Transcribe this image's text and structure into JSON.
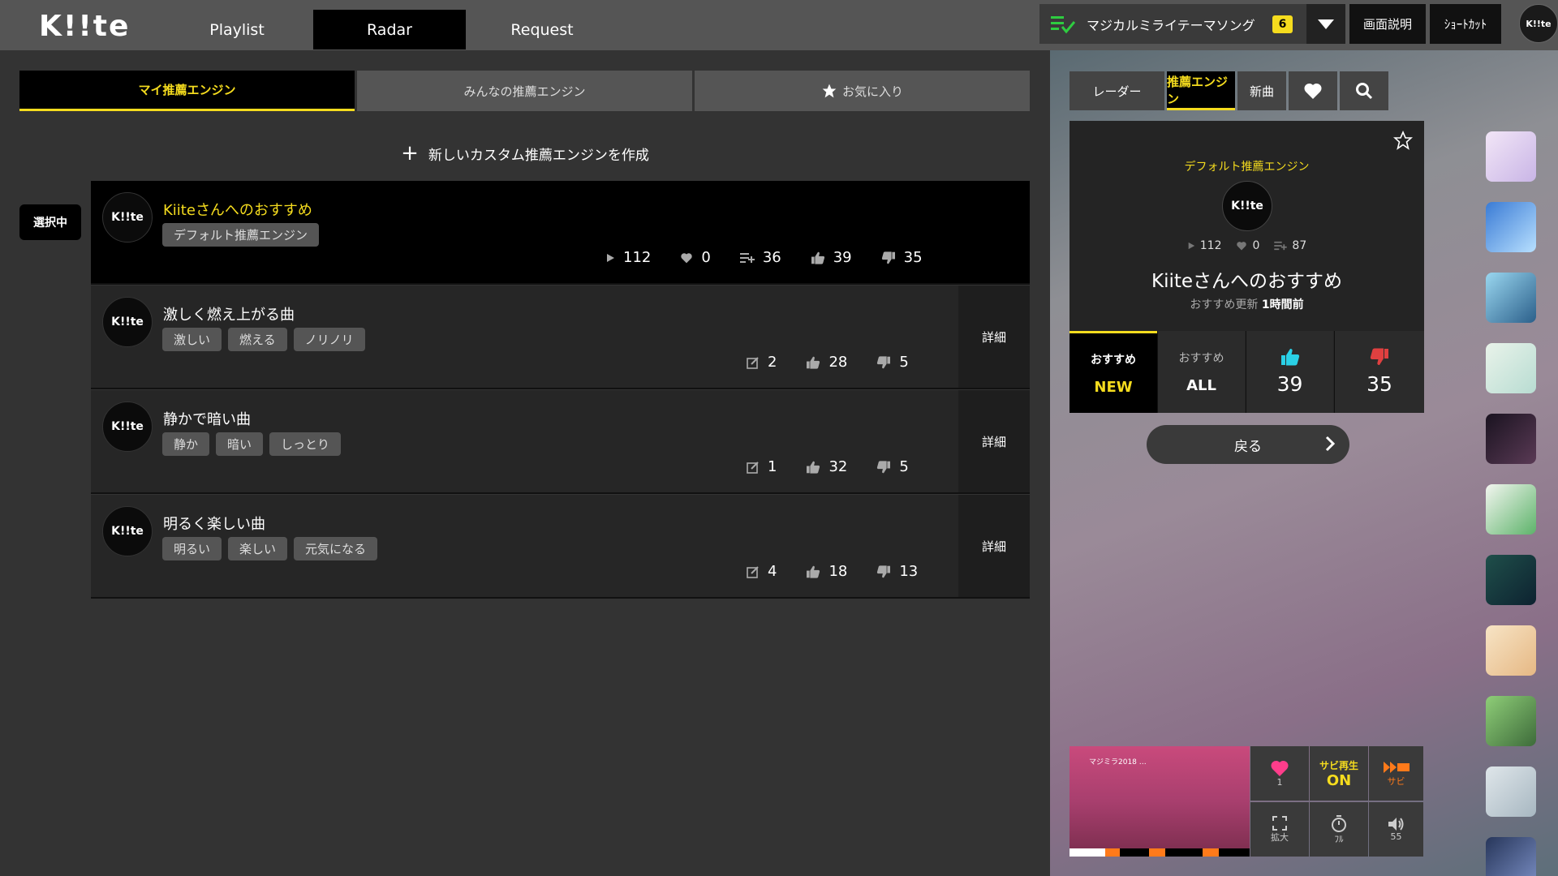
{
  "app": {
    "logo": "K!!te"
  },
  "nav": {
    "tabs": [
      {
        "label": "Playlist"
      },
      {
        "label": "Radar"
      },
      {
        "label": "Request"
      }
    ]
  },
  "header": {
    "queue_title": "マジカルミライテーマソング",
    "queue_count": "6",
    "help_label": "画面説明",
    "shortcut_label": "ｼｮｰﾄｶｯﾄ",
    "avatar_label": "K!!te"
  },
  "engine_tabs": [
    {
      "label": "マイ推薦エンジン"
    },
    {
      "label": "みんなの推薦エンジン"
    },
    {
      "label": "お気に入り"
    }
  ],
  "create_label": "新しいカスタム推薦エンジンを作成",
  "selected_label": "選択中",
  "engines": [
    {
      "icon": "K!!te",
      "title": "Kiiteさんへのおすすめ",
      "tags": [
        "デフォルト推薦エンジン"
      ],
      "plays": "112",
      "favs": "0",
      "lists": "36",
      "up": "39",
      "down": "35"
    },
    {
      "icon": "K!!te",
      "title": "激しく燃え上がる曲",
      "tags": [
        "激しい",
        "燃える",
        "ノリノリ"
      ],
      "edits": "2",
      "up": "28",
      "down": "5",
      "detail": "詳細"
    },
    {
      "icon": "K!!te",
      "title": "静かで暗い曲",
      "tags": [
        "静か",
        "暗い",
        "しっとり"
      ],
      "edits": "1",
      "up": "32",
      "down": "5",
      "detail": "詳細"
    },
    {
      "icon": "K!!te",
      "title": "明るく楽しい曲",
      "tags": [
        "明るい",
        "楽しい",
        "元気になる"
      ],
      "edits": "4",
      "up": "18",
      "down": "13",
      "detail": "詳細"
    }
  ],
  "right": {
    "tabs": [
      {
        "label": "レーダー"
      },
      {
        "label": "推薦エンジン"
      },
      {
        "label": "新曲"
      }
    ],
    "card": {
      "default_label": "デフォルト推薦エンジン",
      "icon": "K!!te",
      "plays": "112",
      "favs": "0",
      "lists": "87",
      "title": "Kiiteさんへのおすすめ",
      "updated_prefix": "おすすめ更新",
      "updated_value": "1時間前",
      "buttons": [
        {
          "l1": "おすすめ",
          "l2": "NEW"
        },
        {
          "l1": "おすすめ",
          "l2": "ALL"
        },
        {
          "value": "39"
        },
        {
          "value": "35"
        }
      ]
    },
    "back_label": "戻る",
    "player": {
      "video_text": "マジミラ2018 …",
      "fav_count": "1",
      "sabi_label": "サビ再生",
      "sabi_state": "ON",
      "sabi_btn": "サビ",
      "expand": "拡大",
      "full": "ﾌﾙ",
      "volume": "55"
    }
  },
  "colors": {
    "accent": "#f5dc1e",
    "like": "#2ad0e6",
    "dislike": "#e04040",
    "fav": "#ff3d8b",
    "sabi": "#ff7a1a",
    "queue_icon": "#2ecc40"
  }
}
